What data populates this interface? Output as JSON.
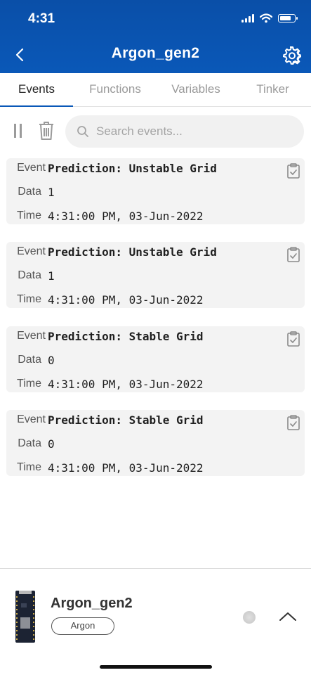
{
  "status_bar": {
    "time": "4:31"
  },
  "header": {
    "title": "Argon_gen2"
  },
  "tabs": [
    {
      "label": "Events",
      "active": true
    },
    {
      "label": "Functions",
      "active": false
    },
    {
      "label": "Variables",
      "active": false
    },
    {
      "label": "Tinker",
      "active": false
    }
  ],
  "search": {
    "placeholder": "Search events..."
  },
  "labels": {
    "event": "Event",
    "data": "Data",
    "time": "Time"
  },
  "events": [
    {
      "event": "Prediction: Unstable Grid",
      "data": "1",
      "time": "4:31:00 PM, 03-Jun-2022"
    },
    {
      "event": "Prediction: Unstable Grid",
      "data": "1",
      "time": "4:31:00 PM, 03-Jun-2022"
    },
    {
      "event": "Prediction: Stable Grid",
      "data": "0",
      "time": "4:31:00 PM, 03-Jun-2022"
    },
    {
      "event": "Prediction: Stable Grid",
      "data": "0",
      "time": "4:31:00 PM, 03-Jun-2022"
    }
  ],
  "device": {
    "name": "Argon_gen2",
    "type": "Argon"
  },
  "colors": {
    "header": "#0a58b8",
    "card": "#f3f3f3",
    "accent": "#0a58b8"
  }
}
